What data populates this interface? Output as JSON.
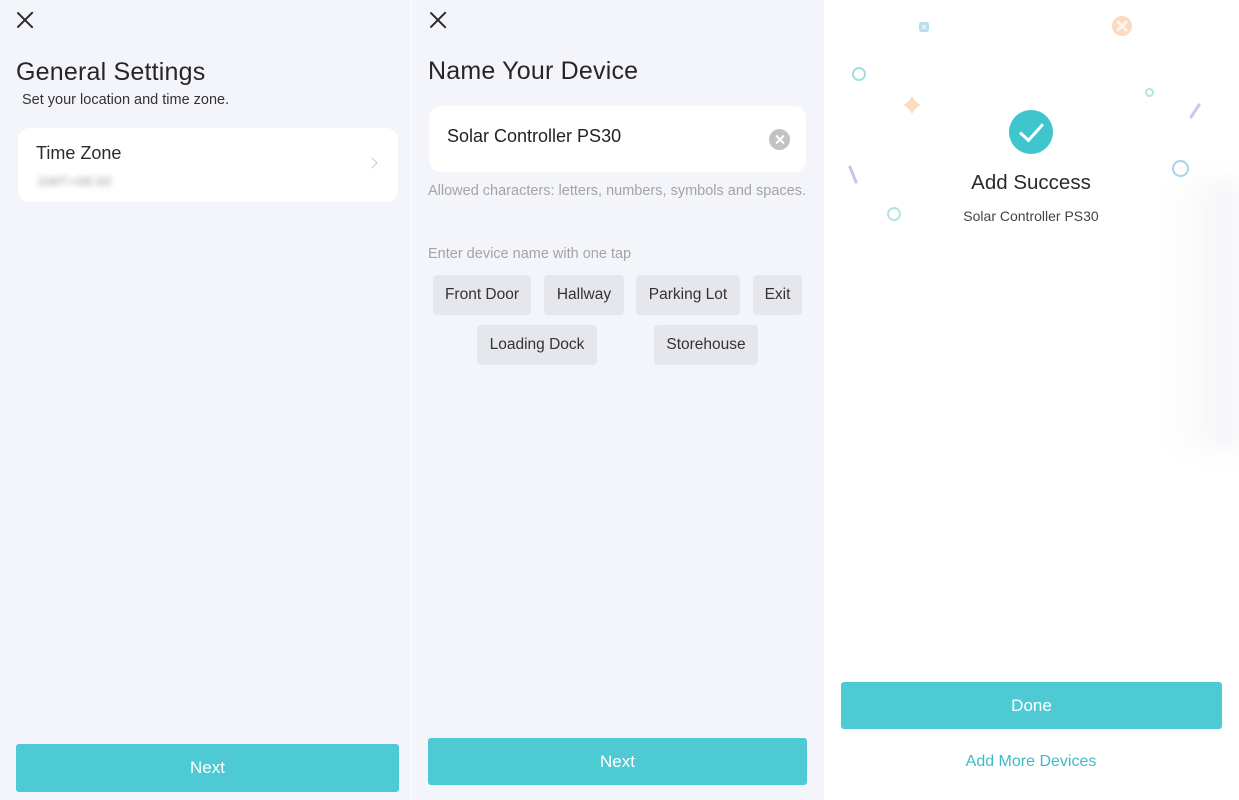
{
  "general_settings": {
    "title": "General Settings",
    "subtitle": "Set your location and time zone.",
    "time_zone_label": "Time Zone",
    "time_zone_value": "GMT+08:00",
    "next_label": "Next"
  },
  "name_device": {
    "title": "Name Your Device",
    "device_name_value": "Solar Controller PS30",
    "hint": "Allowed characters: letters, numbers, symbols and spaces.",
    "tap_label": "Enter device name with one tap",
    "suggestions": [
      "Front Door",
      "Hallway",
      "Parking Lot",
      "Exit",
      "Loading Dock",
      "Storehouse"
    ],
    "next_label": "Next"
  },
  "add_success": {
    "title": "Add Success",
    "device_name": "Solar Controller PS30",
    "done_label": "Done",
    "add_more_label": "Add More Devices"
  },
  "colors": {
    "accent": "#4dcad4",
    "link": "#3dbcc8",
    "panel_bg": "#f4f5fa"
  }
}
